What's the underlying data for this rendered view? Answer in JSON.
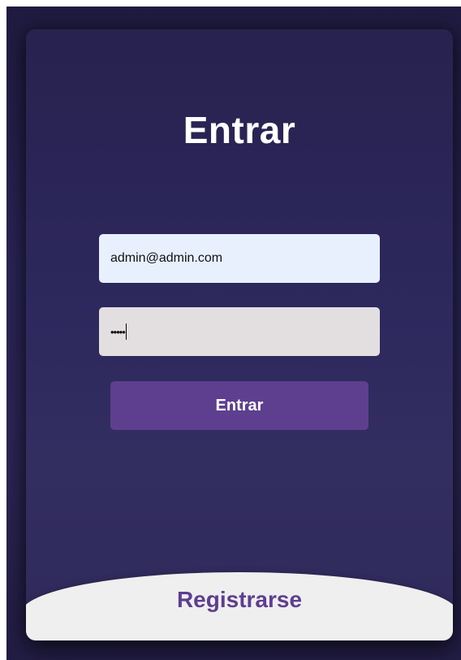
{
  "login": {
    "title": "Entrar",
    "email_value": "admin@admin.com",
    "password_mask": "•••••",
    "submit_label": "Entrar"
  },
  "register": {
    "label": "Registrarse"
  },
  "colors": {
    "background": "#2a2456",
    "button": "#5e3f8f",
    "email_field": "#e8f0fe",
    "password_field": "#e3dfe1",
    "register_panel": "#efefef"
  }
}
